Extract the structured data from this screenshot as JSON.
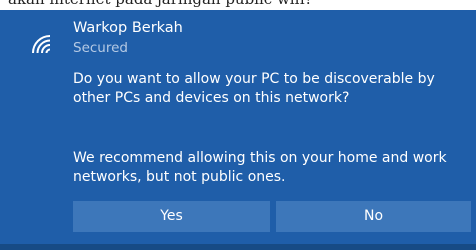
{
  "page_top_text": "akan internet pada jaringan public wifi?",
  "network": {
    "name": "Warkop Berkah",
    "status": "Secured",
    "icon": "wifi-icon"
  },
  "prompt": {
    "question": "Do you want to allow your PC to be discoverable by other PCs and devices on this network?",
    "recommendation": "We recommend allowing this on your home and work networks, but not public ones."
  },
  "buttons": {
    "yes_label": "Yes",
    "no_label": "No"
  },
  "colors": {
    "panel_bg": "#1f5ea9",
    "button_bg": "#3d77ba",
    "secondary_text": "#b4c9e4"
  }
}
